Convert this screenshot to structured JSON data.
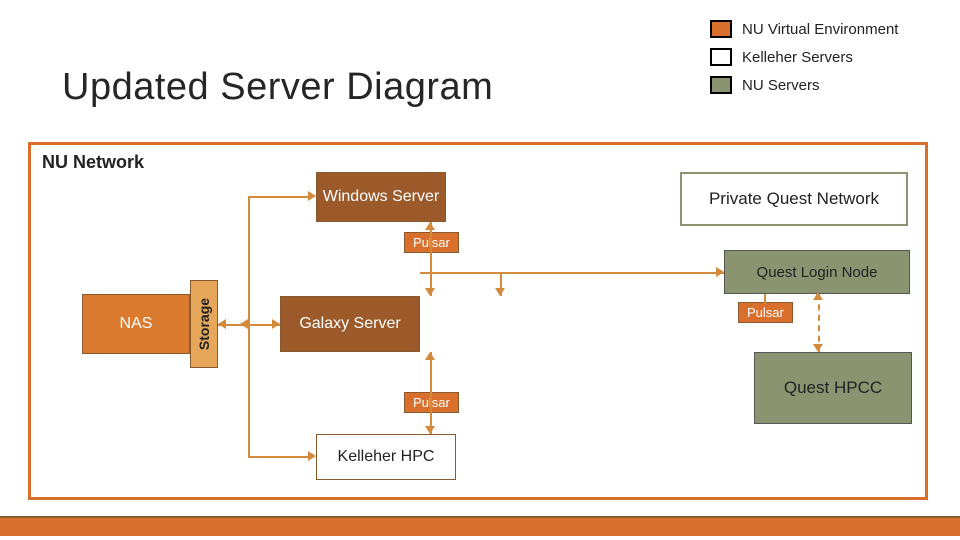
{
  "title": "Updated Server Diagram",
  "legend": {
    "items": [
      {
        "label": "NU Virtual Environment",
        "swatch": "sw-orange"
      },
      {
        "label": "Kelleher Servers",
        "swatch": "sw-white"
      },
      {
        "label": "NU Servers",
        "swatch": "sw-olive"
      }
    ]
  },
  "outer_label": "NU Network",
  "nodes": {
    "nas": "NAS",
    "storage": "Storage",
    "windows": "Windows Server",
    "galaxy": "Galaxy Server",
    "khpc": "Kelleher HPC",
    "pqn": "Private Quest Network",
    "qln": "Quest Login Node",
    "qhpc": "Quest HPCC"
  },
  "tags": {
    "pulsar": "Pulsar"
  },
  "colors": {
    "orange": "#d96f2c",
    "brown": "#9c5a2a",
    "olive": "#8a9471"
  }
}
